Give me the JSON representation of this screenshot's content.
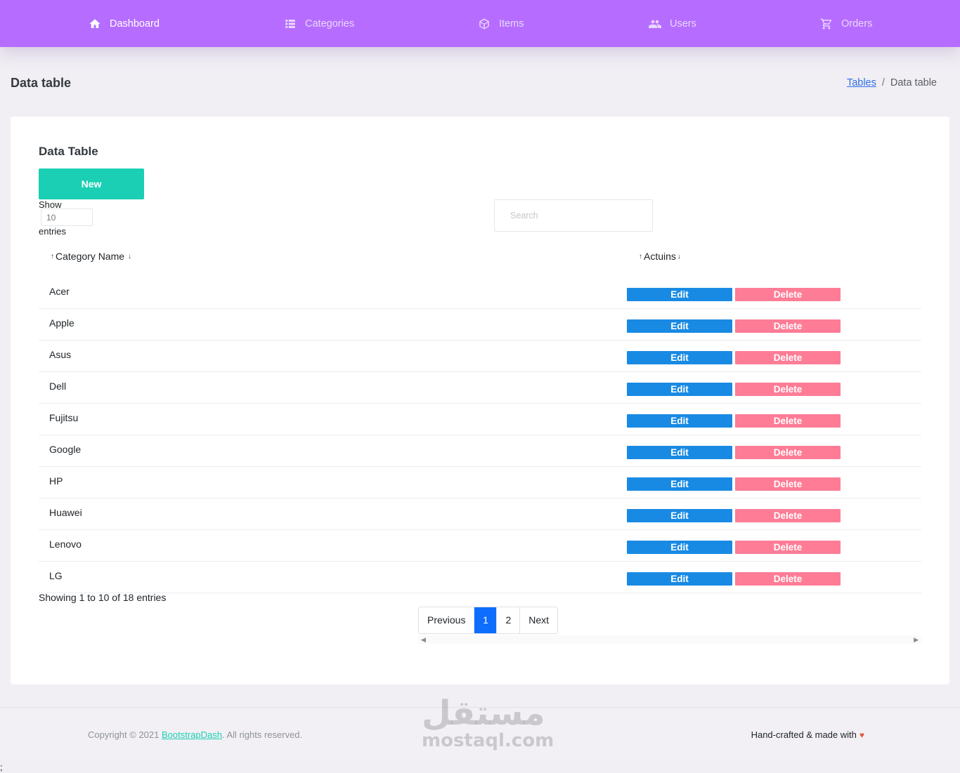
{
  "nav": {
    "items": [
      {
        "label": "Dashboard",
        "icon": "home-icon"
      },
      {
        "label": "Categories",
        "icon": "list-icon"
      },
      {
        "label": "Items",
        "icon": "cube-icon"
      },
      {
        "label": "Users",
        "icon": "users-icon"
      },
      {
        "label": "Orders",
        "icon": "cart-icon"
      }
    ],
    "active": "Dashboard"
  },
  "page": {
    "title": "Data table",
    "breadcrumb": {
      "link": "Tables",
      "separator": "/",
      "current": "Data table"
    }
  },
  "card": {
    "title": "Data Table",
    "new_button": "New",
    "show_label": "Show",
    "entries_value": "10",
    "entries_label": "entries",
    "search_placeholder": "Search"
  },
  "table": {
    "columns": [
      "Category Name",
      "Actuins"
    ],
    "rows": [
      {
        "name": "Acer"
      },
      {
        "name": "Apple"
      },
      {
        "name": "Asus"
      },
      {
        "name": "Dell"
      },
      {
        "name": "Fujitsu"
      },
      {
        "name": "Google"
      },
      {
        "name": "HP"
      },
      {
        "name": "Huawei"
      },
      {
        "name": "Lenovo"
      },
      {
        "name": "LG"
      }
    ],
    "edit_label": "Edit",
    "delete_label": "Delete"
  },
  "pagination": {
    "info": "Showing 1 to 10 of 18 entries",
    "previous": "Previous",
    "pages": [
      "1",
      "2"
    ],
    "current_page": "1",
    "next": "Next"
  },
  "footer": {
    "copyright_prefix": "Copyright © 2021 ",
    "copyright_link": "BootstrapDash",
    "copyright_suffix": ". All rights reserved.",
    "handcrafted": "Hand-crafted & made with",
    "watermark_ar": "مستقل",
    "watermark_en": "mostaql.com"
  },
  "stray_text": ";",
  "colors": {
    "nav_bg": "#b66dff",
    "new_button": "#1bcfb4",
    "edit_button": "#198ae3",
    "delete_button": "#fe7c96",
    "page_active": "#0d6efd"
  }
}
